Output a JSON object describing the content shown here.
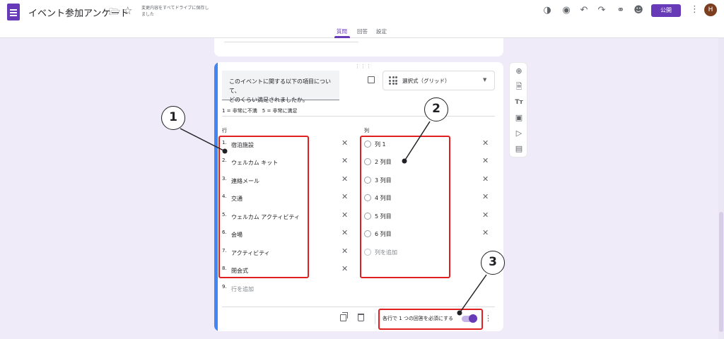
{
  "header": {
    "title": "イベント参加アンケート",
    "save_status": "変更内容をすべてドライブに保存しました",
    "publish_label": "公開",
    "avatar_initial": "H"
  },
  "tabs": [
    {
      "label": "質問",
      "active": true
    },
    {
      "label": "回答",
      "active": false
    },
    {
      "label": "設定",
      "active": false
    }
  ],
  "question": {
    "text_line1": "このイベントに関する以下の項目について、",
    "text_line2": "どのくらい満足されましたか。",
    "type_label": "選択式（グリッド）",
    "scale_note": "1 = 非常に不満　5 = 非常に満足",
    "rows_header": "行",
    "columns_header": "列",
    "rows": [
      {
        "num": "1.",
        "label": "宿泊施設"
      },
      {
        "num": "2.",
        "label": "ウェルカム キット"
      },
      {
        "num": "3.",
        "label": "連絡メール"
      },
      {
        "num": "4.",
        "label": "交通"
      },
      {
        "num": "5.",
        "label": "ウェルカム アクティビティ"
      },
      {
        "num": "6.",
        "label": "会場"
      },
      {
        "num": "7.",
        "label": "アクティビティ"
      },
      {
        "num": "8.",
        "label": "閉会式"
      }
    ],
    "add_row": {
      "num": "9.",
      "label": "行を追加"
    },
    "columns": [
      {
        "label": "列 1"
      },
      {
        "label": "2 列目"
      },
      {
        "label": "3 列目"
      },
      {
        "label": "4 列目"
      },
      {
        "label": "5 列目"
      },
      {
        "label": "6 列目"
      }
    ],
    "add_column_label": "列を追加",
    "required_label": "各行で 1 つの回答を必須にする",
    "required_on": true
  },
  "callouts": [
    "1",
    "2",
    "3"
  ],
  "colors": {
    "accent": "#673ab7",
    "background": "#f0ebf8",
    "highlight": "#e02020",
    "card_accent": "#4285f4"
  }
}
